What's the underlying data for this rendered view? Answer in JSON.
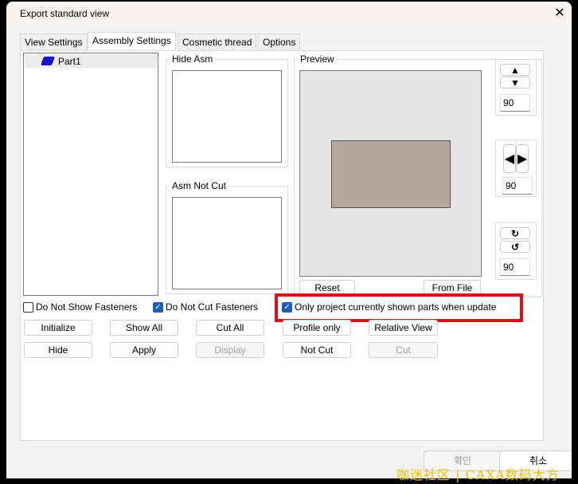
{
  "window": {
    "title": "Export standard view",
    "close_icon": "close-icon"
  },
  "tabs": [
    {
      "label": "View Settings"
    },
    {
      "label": "Assembly Settings",
      "active": true
    },
    {
      "label": "Cosmetic thread"
    },
    {
      "label": "Options"
    }
  ],
  "tree": {
    "items": [
      {
        "label": "Part1",
        "icon": "part-icon"
      }
    ]
  },
  "groups": {
    "hide_asm": "Hide Asm",
    "asm_not_cut": "Asm Not Cut",
    "preview": "Preview"
  },
  "preview": {
    "reset": "Reset",
    "from_file": "From File",
    "part_color": "#b5a79c"
  },
  "rotation": {
    "vertical": "90",
    "horizontal": "90",
    "spin": "90"
  },
  "checkboxes": [
    {
      "label": "Do Not Show Fasteners",
      "checked": false
    },
    {
      "label": "Do Not Cut Fasteners",
      "checked": true
    },
    {
      "label": "Only project currently shown parts when update",
      "checked": true
    }
  ],
  "buttons": {
    "initialize": "Initialize",
    "show_all": "Show All",
    "cut_all": "Cut All",
    "profile_only": "Profile only",
    "relative_view": "Relative View",
    "hide": "Hide",
    "apply": "Apply",
    "display": "Display",
    "not_cut": "Not Cut",
    "cut": "Cut"
  },
  "footer": {
    "ok": "확인",
    "cancel": "취소"
  },
  "watermark": "咖迷社区 | CAXA数码大方",
  "highlight_color": "#e0101a"
}
